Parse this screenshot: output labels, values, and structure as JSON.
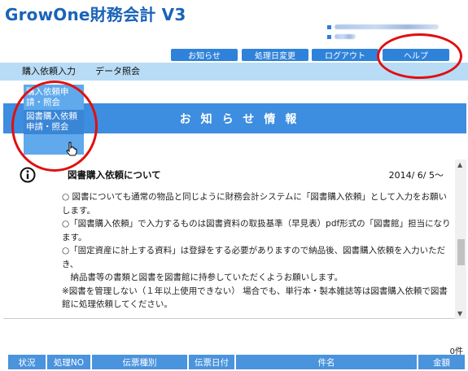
{
  "app": {
    "title": "GrowOne財務会計 V3"
  },
  "header_buttons": [
    {
      "label": "お知らせ"
    },
    {
      "label": "処理日変更"
    },
    {
      "label": "ログアウト"
    },
    {
      "label": "ヘルプ"
    }
  ],
  "menu": [
    {
      "label": "購入依頼入力"
    },
    {
      "label": "データ照会"
    }
  ],
  "dropdown": [
    {
      "label": "購入依頼申請・照会"
    },
    {
      "label": "図書購入依頼申請・照会"
    }
  ],
  "banner": {
    "title": "お知らせ情報"
  },
  "news": {
    "heading": "図書購入依頼について",
    "date": "2014/ 6/ 5～",
    "lines": [
      "○ 図書についても通常の物品と同じように財務会計システムに「図書購入依頼」として入力をお願いします。",
      "○「図書購入依頼」で入力するものは図書資料の取扱基準（早見表）pdf形式の「図書館」担当になります。",
      "○「固定資産に計上する資料」は登録をする必要がありますので納品後、図書購入依頼を入力いただき、",
      "　納品書等の書類と図書を図書館に持参していただくようお願いします。",
      "※図書を管理しない（１年以上使用できない） 場合でも、単行本・製本雑誌等は図書購入依頼で図書館に処理依頼してください。"
    ]
  },
  "result_count": "0件",
  "table_columns": [
    "状況",
    "処理NO",
    "伝票種別",
    "伝票日付",
    "件名",
    "金額"
  ],
  "colors": {
    "accent": "#3d8de0",
    "title": "#1a63b8",
    "menubar": "#b8dcf6",
    "annotation": "#e01010"
  }
}
